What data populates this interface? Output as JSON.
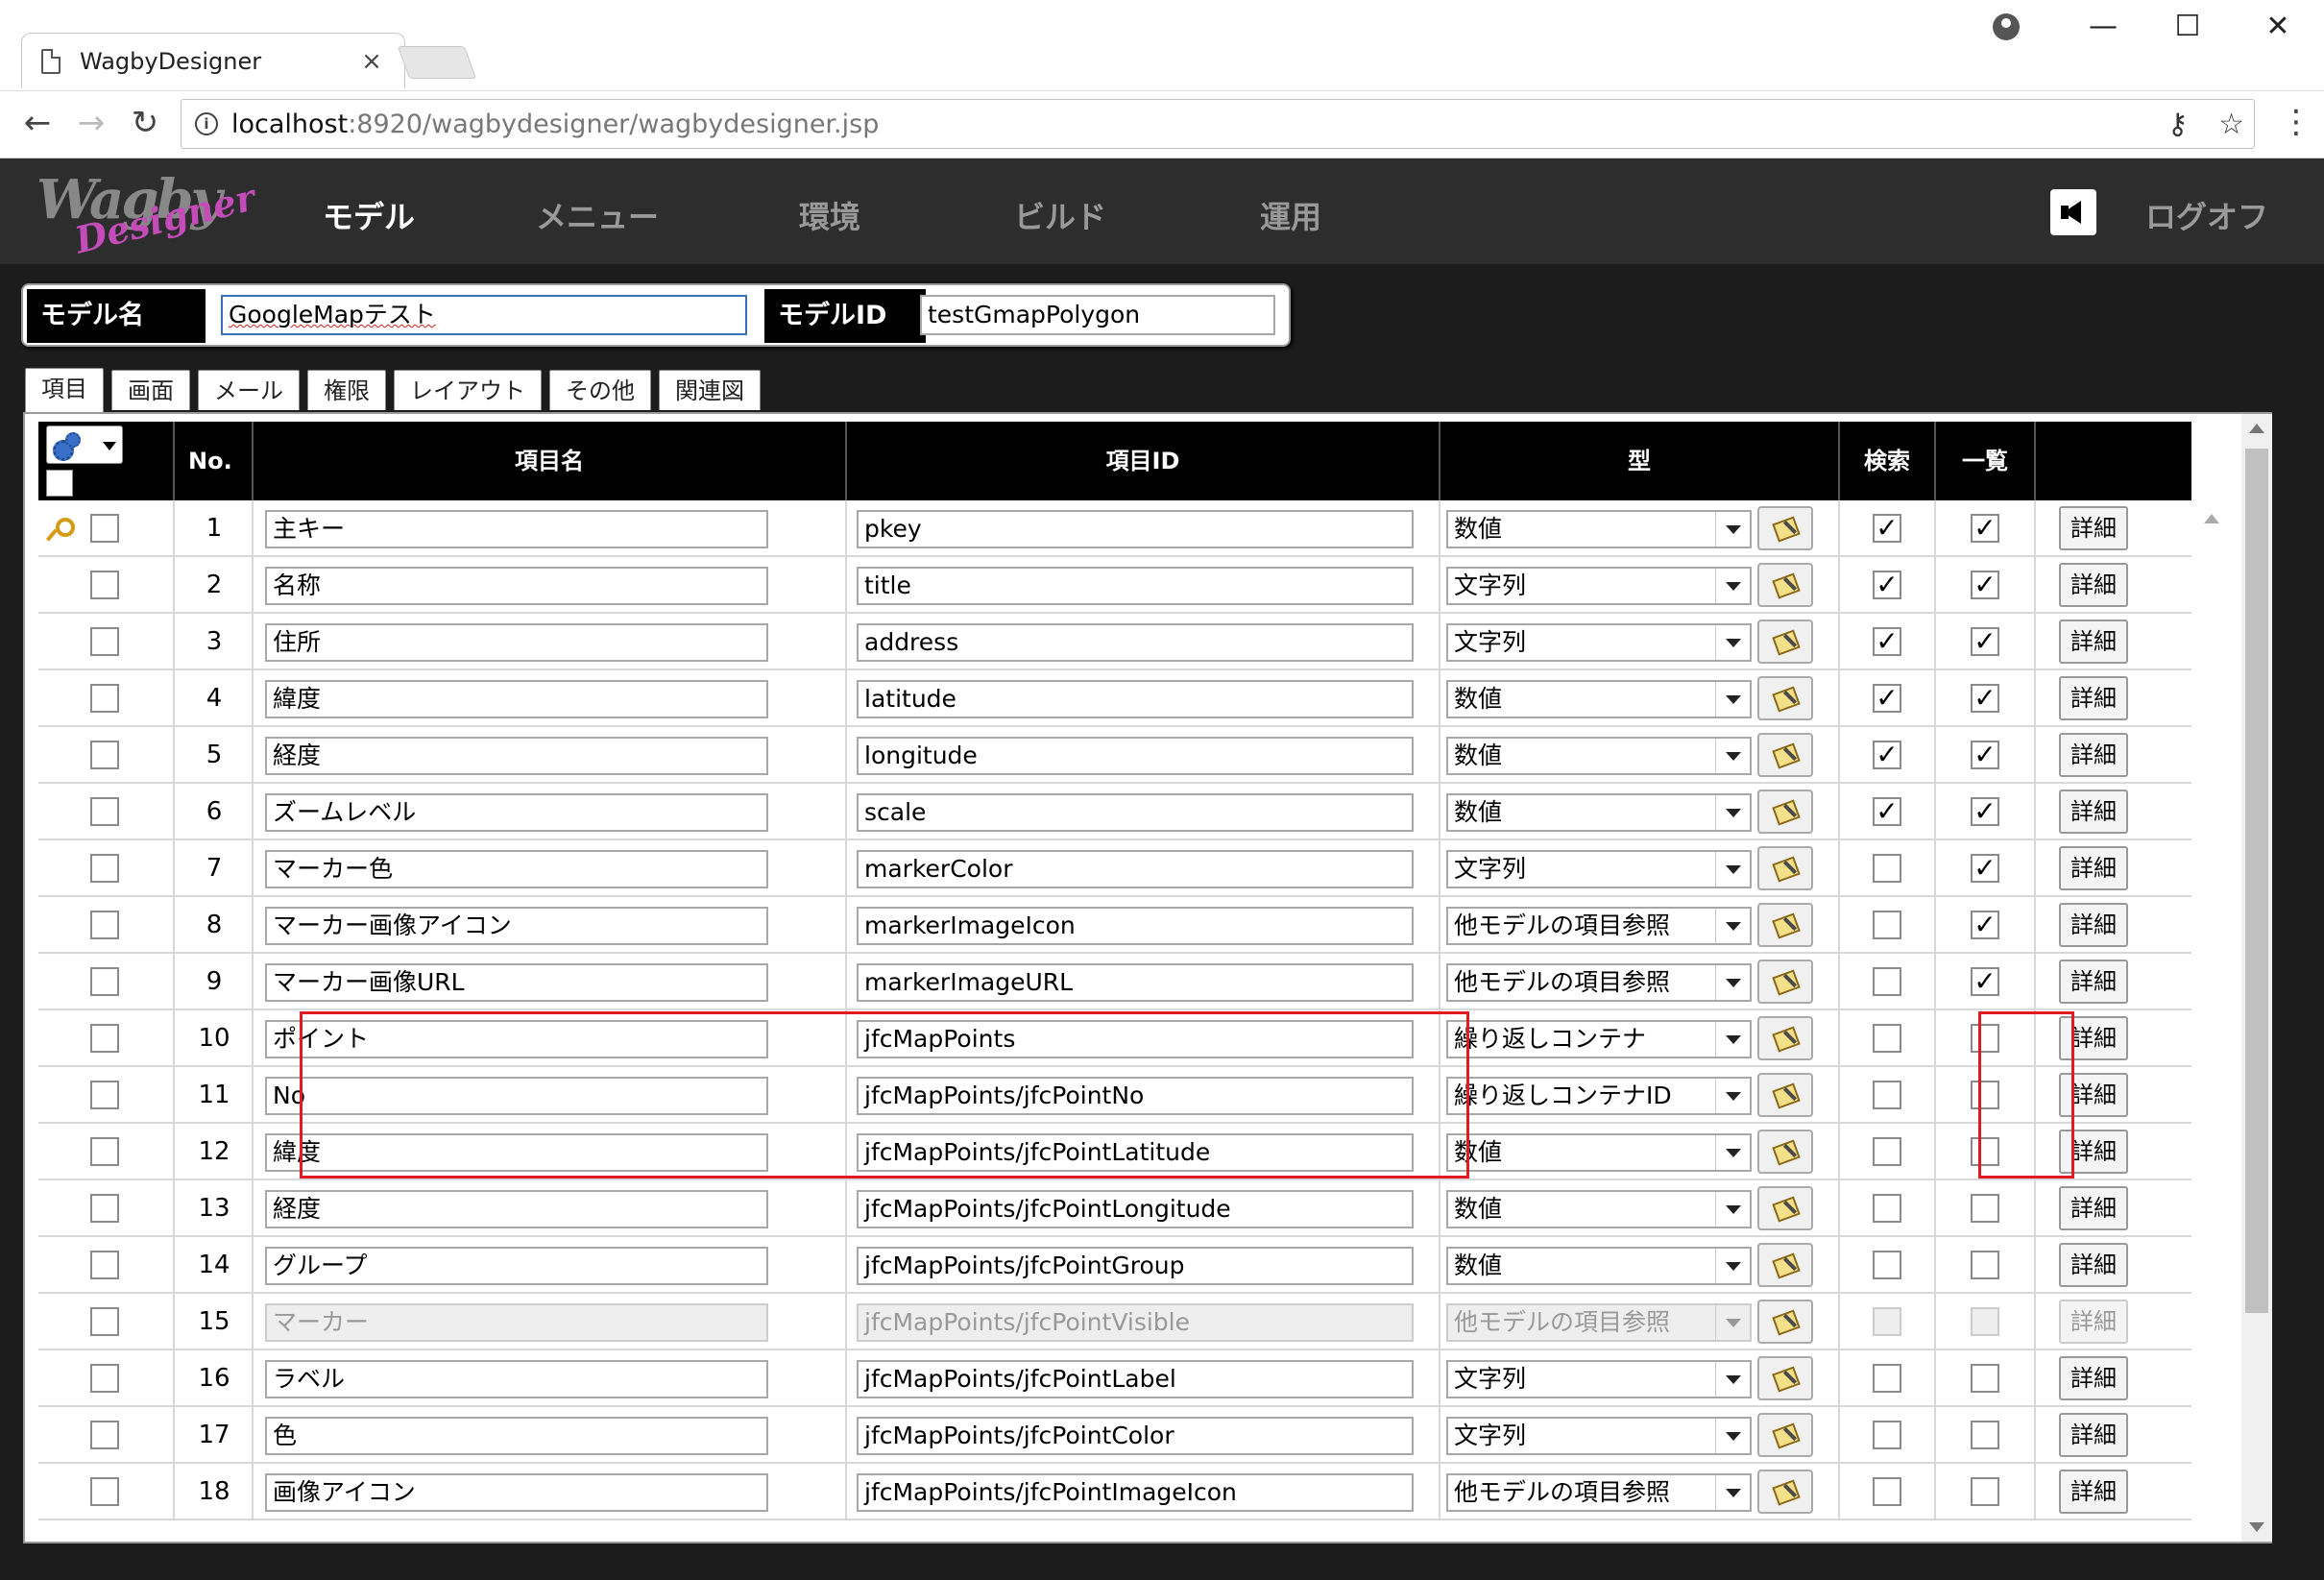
{
  "browser": {
    "tab_title": "WagbyDesigner",
    "tab_close": "×",
    "url_host": "localhost",
    "url_rest": ":8920/wagbydesigner/wagbydesigner.jsp",
    "back": "←",
    "forward": "→",
    "reload": "↻",
    "minimize": "—",
    "maximize": "☐",
    "close": "✕",
    "key_icon": "⚷",
    "star": "☆",
    "menu": "⋮"
  },
  "app": {
    "logo": "Wagby",
    "logo_sub": "Designer",
    "nav": [
      "モデル",
      "メニュー",
      "環境",
      "ビルド",
      "運用"
    ],
    "active_nav": "モデル",
    "logoff": "ログオフ"
  },
  "model": {
    "name_label": "モデル名",
    "name_value": "GoogleMapテスト",
    "id_label": "モデルID",
    "id_value": "testGmapPolygon"
  },
  "tabs": [
    "項目",
    "画面",
    "メール",
    "権限",
    "レイアウト",
    "その他",
    "関連図"
  ],
  "grid": {
    "headers": {
      "no": "No.",
      "name": "項目名",
      "id": "項目ID",
      "type": "型",
      "search": "検索",
      "list": "一覧"
    },
    "detail_label": "詳細",
    "check_mark": "✓",
    "rows": [
      {
        "no": "1",
        "name": "主キー",
        "id": "pkey",
        "type": "数値",
        "search": true,
        "list": true,
        "key": true
      },
      {
        "no": "2",
        "name": "名称",
        "id": "title",
        "type": "文字列",
        "search": true,
        "list": true
      },
      {
        "no": "3",
        "name": "住所",
        "id": "address",
        "type": "文字列",
        "search": true,
        "list": true
      },
      {
        "no": "4",
        "name": "緯度",
        "id": "latitude",
        "type": "数値",
        "search": true,
        "list": true
      },
      {
        "no": "5",
        "name": "経度",
        "id": "longitude",
        "type": "数値",
        "search": true,
        "list": true
      },
      {
        "no": "6",
        "name": "ズームレベル",
        "id": "scale",
        "type": "数値",
        "search": true,
        "list": true
      },
      {
        "no": "7",
        "name": "マーカー色",
        "id": "markerColor",
        "type": "文字列",
        "search": false,
        "list": true
      },
      {
        "no": "8",
        "name": "マーカー画像アイコン",
        "id": "markerImageIcon",
        "type": "他モデルの項目参照",
        "search": false,
        "list": true
      },
      {
        "no": "9",
        "name": "マーカー画像URL",
        "id": "markerImageURL",
        "type": "他モデルの項目参照",
        "search": false,
        "list": true
      },
      {
        "no": "10",
        "name": "ポイント",
        "id": "jfcMapPoints",
        "type": "繰り返しコンテナ",
        "search": false,
        "list": false
      },
      {
        "no": "11",
        "name": "No",
        "id": "jfcMapPoints/jfcPointNo",
        "type": "繰り返しコンテナID",
        "search": false,
        "list": false
      },
      {
        "no": "12",
        "name": "緯度",
        "id": "jfcMapPoints/jfcPointLatitude",
        "type": "数値",
        "search": false,
        "list": false
      },
      {
        "no": "13",
        "name": "経度",
        "id": "jfcMapPoints/jfcPointLongitude",
        "type": "数値",
        "search": false,
        "list": false
      },
      {
        "no": "14",
        "name": "グループ",
        "id": "jfcMapPoints/jfcPointGroup",
        "type": "数値",
        "search": false,
        "list": false
      },
      {
        "no": "15",
        "name": "マーカー",
        "id": "jfcMapPoints/jfcPointVisible",
        "type": "他モデルの項目参照",
        "search": false,
        "list": false,
        "disabled": true
      },
      {
        "no": "16",
        "name": "ラベル",
        "id": "jfcMapPoints/jfcPointLabel",
        "type": "文字列",
        "search": false,
        "list": false
      },
      {
        "no": "17",
        "name": "色",
        "id": "jfcMapPoints/jfcPointColor",
        "type": "文字列",
        "search": false,
        "list": false
      },
      {
        "no": "18",
        "name": "画像アイコン",
        "id": "jfcMapPoints/jfcPointImageIcon",
        "type": "他モデルの項目参照",
        "search": false,
        "list": false
      }
    ]
  },
  "colors": {
    "highlight": "#e01b24",
    "header_bg": "#2d2d2d",
    "app_bg": "#1c1c1c"
  }
}
